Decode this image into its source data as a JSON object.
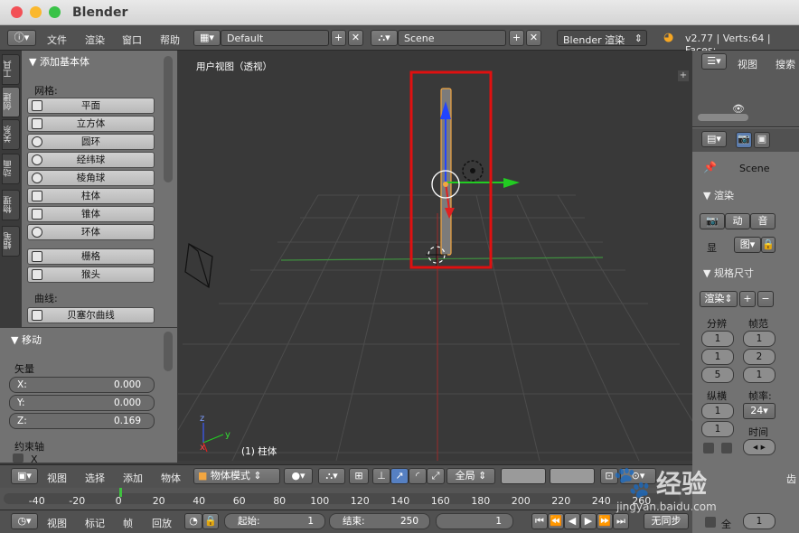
{
  "window": {
    "title": "Blender",
    "close_color": "#f25056",
    "min_color": "#fab82e",
    "max_color": "#39c247"
  },
  "menubar": {
    "items": [
      "文件",
      "渲染",
      "窗口",
      "帮助"
    ],
    "screen_layout": "Default",
    "scene": "Scene",
    "engine": "Blender 渲染",
    "status": "v2.77 | Verts:64 | Faces:"
  },
  "tool_tabs": [
    "工具",
    "创建",
    "关系",
    "动画",
    "物理",
    "蜡笔"
  ],
  "add_panel": {
    "title": "添加基本体",
    "mesh_label": "网格:",
    "mesh_items": [
      "平面",
      "立方体",
      "圆环",
      "经纬球",
      "棱角球",
      "柱体",
      "锥体",
      "环体"
    ],
    "extra_items": [
      "栅格",
      "猴头"
    ],
    "curve_label": "曲线:",
    "curve_items": [
      "贝塞尔曲线"
    ]
  },
  "move_panel": {
    "title": "移动",
    "vector_label": "矢量",
    "x_label": "X:",
    "x_value": "0.000",
    "y_label": "Y:",
    "y_value": "0.000",
    "z_label": "Z:",
    "z_value": "0.169",
    "constraint_label": "约束轴",
    "constraint_x": "X"
  },
  "viewport": {
    "view_label": "用户视图（透视）",
    "object_label": "(1) 柱体",
    "axis_z": "z",
    "axis_x": "x",
    "axis_y": "y",
    "highlight_color": "#e01010"
  },
  "header3d": {
    "items": [
      "视图",
      "选择",
      "添加",
      "物体"
    ],
    "mode": "物体模式",
    "pivot": "全局"
  },
  "timeline": {
    "ticks": [
      "-40",
      "-20",
      "0",
      "20",
      "40",
      "60",
      "80",
      "100",
      "120",
      "140",
      "160",
      "180",
      "200",
      "220",
      "240",
      "260"
    ]
  },
  "timeline_header": {
    "items": [
      "视图",
      "标记",
      "帧",
      "回放"
    ],
    "start_label": "起始:",
    "start_value": "1",
    "end_label": "结束:",
    "end_value": "250",
    "current": "1",
    "sync": "无同步"
  },
  "right": {
    "outliner_view": "视图",
    "outliner_search": "搜索",
    "scene": "Scene",
    "render_title": "渲染",
    "render_btn1": "渲",
    "render_btn2": "动",
    "render_btn3": "音",
    "display_label": "显",
    "display_value": "图",
    "dims_title": "规格尺寸",
    "preset": "渲染",
    "res_label": "分辨",
    "frame_label": "帧范",
    "res_values": [
      "1",
      "1",
      "5"
    ],
    "frame_values": [
      "1",
      "2",
      "1"
    ],
    "aspect_label": "纵横",
    "fps_label": "帧率:",
    "aspect_values": [
      "1",
      "1"
    ],
    "fps_value": "24",
    "time_label": "时间",
    "bottom_value": "1",
    "full_label": "全",
    "edge_label": "齿"
  },
  "watermark": {
    "text": "经验",
    "url": "jingyan.baidu.com"
  }
}
